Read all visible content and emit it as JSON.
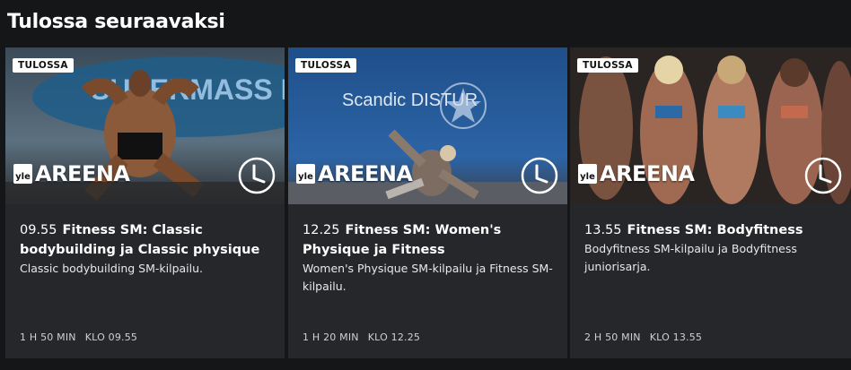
{
  "section": {
    "title": "Tulossa seuraavaksi"
  },
  "brand": {
    "yle": "yle",
    "areena": "AREENA"
  },
  "cards": [
    {
      "badge": "TULOSSA",
      "time": "09.55",
      "name": "Fitness SM: Classic bodybuilding ja Classic physique",
      "description": "Classic bodybuilding SM-kilpailu.",
      "duration": "1 H 50 MIN",
      "klo": "KLO 09.55",
      "thumb_alt": "Classic bodybuilding competitor posing",
      "bg_sign": "SUPERMASS NUTRITION"
    },
    {
      "badge": "TULOSSA",
      "time": "12.25",
      "name": "Fitness SM: Women's Physique ja Fitness",
      "description": "Women's Physique SM-kilpailu ja Fitness SM-kilpailu.",
      "duration": "1 H 20 MIN",
      "klo": "KLO 12.25",
      "thumb_alt": "Fitness athlete performing on stage",
      "bg_sign": "Scandic DISTUR"
    },
    {
      "badge": "TULOSSA",
      "time": "13.55",
      "name": "Fitness SM: Bodyfitness",
      "description": "Bodyfitness SM-kilpailu ja Bodyfitness juniorisarja.",
      "duration": "2 H 50 MIN",
      "klo": "KLO 13.55",
      "thumb_alt": "Bodyfitness competitors lined up"
    }
  ],
  "colors": {
    "page_bg": "#151618",
    "card_bg": "#25272a",
    "badge_bg": "#ffffff"
  },
  "icons": {
    "clock": "clock-icon"
  }
}
